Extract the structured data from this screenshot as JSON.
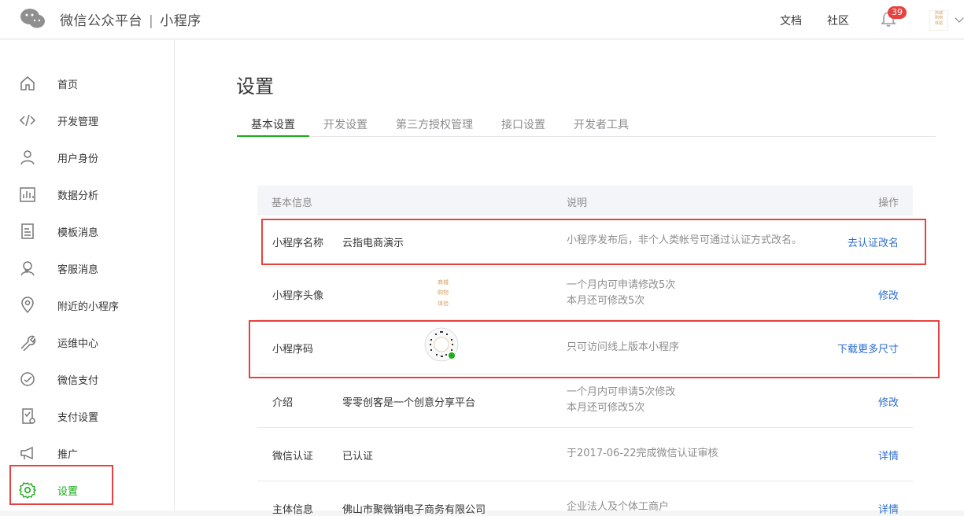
{
  "header": {
    "brand": "微信公众平台",
    "separator": "|",
    "product": "小程序",
    "docs_link": "文档",
    "community_link": "社区",
    "notification_count": "39",
    "avatar_text": [
      "商城",
      "购物",
      "体验"
    ]
  },
  "sidebar": {
    "items": [
      {
        "label": "首页",
        "icon": "home-icon"
      },
      {
        "label": "开发管理",
        "icon": "code-icon"
      },
      {
        "label": "用户身份",
        "icon": "user-icon"
      },
      {
        "label": "数据分析",
        "icon": "bar-chart-icon"
      },
      {
        "label": "模板消息",
        "icon": "document-icon"
      },
      {
        "label": "客服消息",
        "icon": "customer-service-icon"
      },
      {
        "label": "附近的小程序",
        "icon": "location-pin-icon"
      },
      {
        "label": "运维中心",
        "icon": "wrench-icon"
      },
      {
        "label": "微信支付",
        "icon": "wechat-pay-icon"
      },
      {
        "label": "支付设置",
        "icon": "payment-settings-icon"
      },
      {
        "label": "推广",
        "icon": "megaphone-icon"
      },
      {
        "label": "设置",
        "icon": "gear-icon",
        "active": true
      }
    ]
  },
  "main": {
    "title": "设置",
    "tabs": [
      {
        "label": "基本设置",
        "active": true
      },
      {
        "label": "开发设置"
      },
      {
        "label": "第三方授权管理"
      },
      {
        "label": "接口设置"
      },
      {
        "label": "开发者工具"
      }
    ],
    "table": {
      "headers": {
        "info": "基本信息",
        "desc": "说明",
        "action": "操作"
      },
      "rows": [
        {
          "name": "小程序名称",
          "value": "云指电商演示",
          "desc": [
            "小程序发布后，非个人类帐号可通过认证方式改名。"
          ],
          "action": "去认证改名"
        },
        {
          "name": "小程序头像",
          "value": "",
          "image": [
            "商城",
            "购物",
            "体验"
          ],
          "desc": [
            "一个月内可申请修改5次",
            "本月还可修改5次"
          ],
          "action": "修改"
        },
        {
          "name": "小程序码",
          "value": "",
          "desc": [
            "只可访问线上版本小程序"
          ],
          "action": "下载更多尺寸"
        },
        {
          "name": "介绍",
          "value": "零零创客是一个创意分享平台",
          "desc": [
            "一个月内可申请5次修改",
            "本月还可修改5次"
          ],
          "action": "修改"
        },
        {
          "name": "微信认证",
          "value": "已认证",
          "desc": [
            "于2017-06-22完成微信认证审核"
          ],
          "action": "详情"
        },
        {
          "name": "主体信息",
          "value": "佛山市聚微销电子商务有限公司",
          "desc": [
            "企业法人及个体工商户"
          ],
          "action": "详情"
        }
      ]
    }
  },
  "colors": {
    "accent_green": "#1aad19",
    "link_blue": "#2d6ecf",
    "highlight_red": "#e64340",
    "badge_red": "#e64340"
  }
}
